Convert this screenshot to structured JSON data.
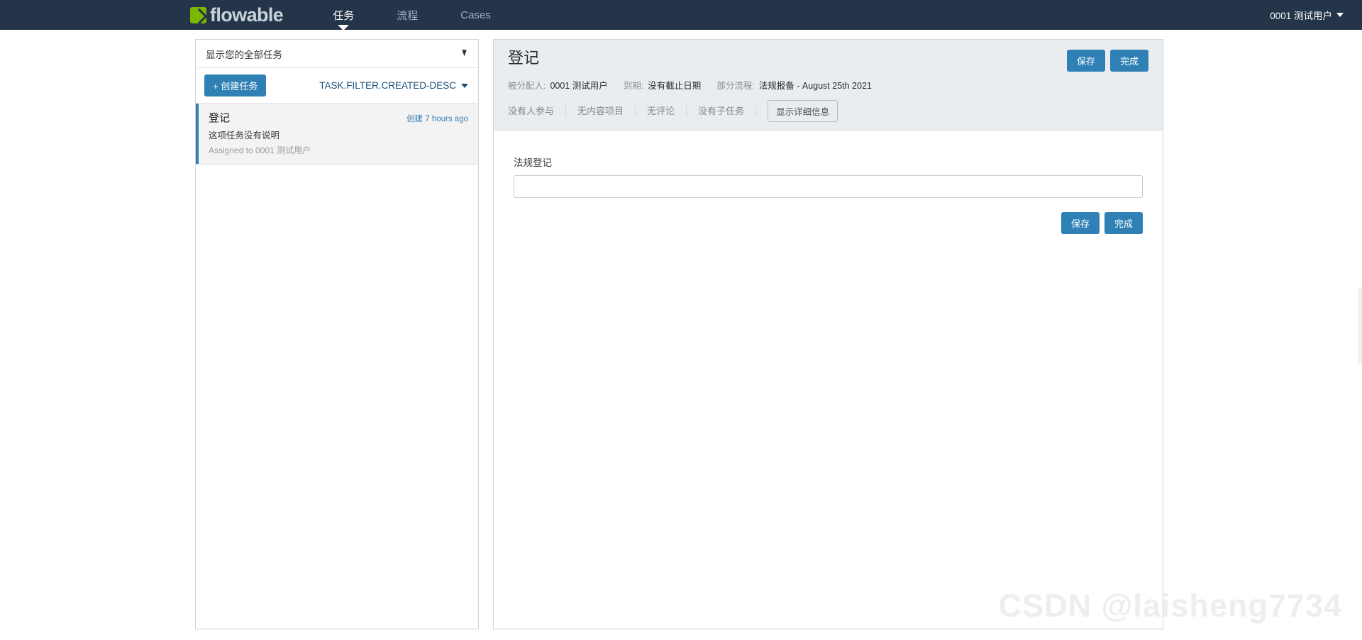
{
  "navbar": {
    "brand": "flowable",
    "brand_icon": "flowable-leaf-icon",
    "items": [
      {
        "label": "任务",
        "active": true
      },
      {
        "label": "流程",
        "active": false
      },
      {
        "label": "Cases",
        "active": false
      }
    ],
    "user": {
      "label": "0001 测试用户",
      "caret_icon": "chevron-down-icon"
    }
  },
  "task_panel": {
    "filter_label": "显示您的全部任务",
    "filter_icon": "funnel-icon",
    "create_button": "+ 创建任务",
    "sort": {
      "label": "TASK.FILTER.CREATED-DESC",
      "caret_icon": "chevron-down-icon"
    },
    "tasks": [
      {
        "title": "登记",
        "time": "创建 7 hours ago",
        "description": "这项任务没有说明",
        "assignee": "Assigned to 0001 测试用户",
        "selected": true
      }
    ]
  },
  "detail_panel": {
    "title": "登记",
    "header_buttons": [
      {
        "label": "保存",
        "name": "save-button"
      },
      {
        "label": "完成",
        "name": "complete-button"
      }
    ],
    "meta": [
      {
        "label": "被分配人:",
        "value": "0001 测试用户"
      },
      {
        "label": "到期:",
        "value": "没有截止日期"
      },
      {
        "label": "部分流程:",
        "value": "法规报备 - August 25th 2021"
      }
    ],
    "tabs": [
      {
        "label": "没有人参与"
      },
      {
        "label": "无内容项目"
      },
      {
        "label": "无评论"
      },
      {
        "label": "没有子任务"
      }
    ],
    "details_button": "显示详细信息",
    "form": {
      "label": "法规登记",
      "value": "",
      "placeholder": ""
    },
    "footer_buttons": [
      {
        "label": "保存",
        "name": "save-button"
      },
      {
        "label": "完成",
        "name": "complete-button"
      }
    ]
  },
  "watermark": "CSDN @laisheng7734",
  "colors": {
    "navbar_bg": "#24354a",
    "accent": "#2f80b5",
    "brand_green": "#7ab800",
    "header_bg": "#eaedf0"
  }
}
